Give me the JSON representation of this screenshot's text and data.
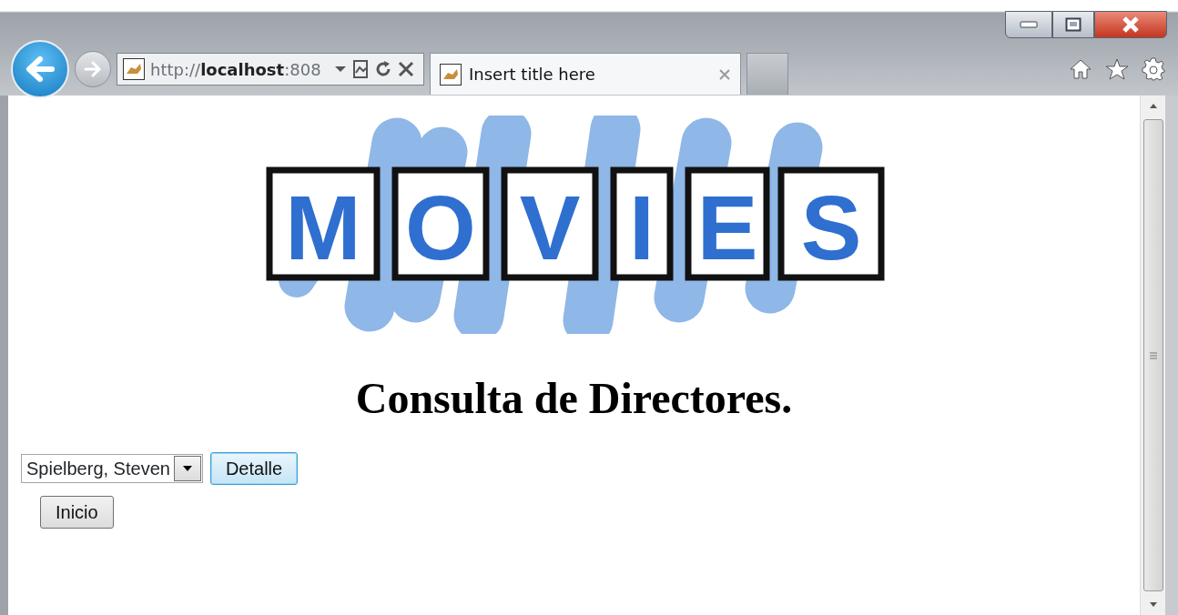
{
  "browser": {
    "address": "http://**localhost**:808",
    "tabs": [
      {
        "title": "Insert title here",
        "selected": true
      }
    ]
  },
  "page": {
    "logo": {
      "letters": [
        "M",
        "O",
        "V",
        "I",
        "E",
        "S"
      ]
    },
    "heading": "Consulta de Directores.",
    "director_select": {
      "value": "Spielberg, Steven"
    },
    "buttons": [
      {
        "label": "Detalle",
        "focused": true
      },
      {
        "label": "Inicio",
        "focused": false
      }
    ]
  }
}
